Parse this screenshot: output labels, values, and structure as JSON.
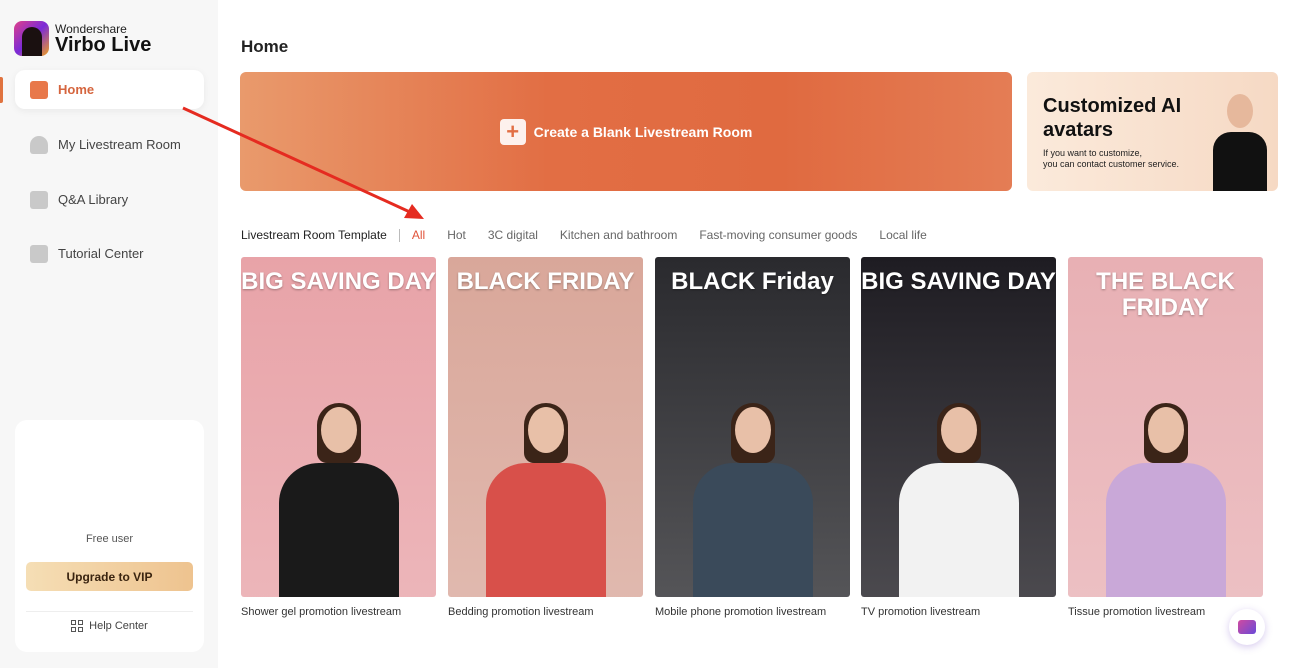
{
  "app": {
    "brand_small": "Wondershare",
    "brand_name": "Virbo Live"
  },
  "sidebar": {
    "items": [
      {
        "label": "Home",
        "icon": "home-icon",
        "active": true
      },
      {
        "label": "My Livestream Room",
        "icon": "avatar-icon"
      },
      {
        "label": "Q&A Library",
        "icon": "document-icon"
      },
      {
        "label": "Tutorial Center",
        "icon": "graduation-cap-icon"
      }
    ],
    "user": {
      "status": "Free user",
      "upgrade_label": "Upgrade to VIP",
      "help_label": "Help Center"
    }
  },
  "main": {
    "title": "Home",
    "create_label": "Create a Blank Livestream Room",
    "promo": {
      "title": "Customized AI avatars",
      "subtitle_line1": "If you want to customize,",
      "subtitle_line2": "you can contact customer service."
    },
    "templates_label": "Livestream Room Template",
    "tabs": [
      "All",
      "Hot",
      "3C digital",
      "Kitchen and bathroom",
      "Fast-moving consumer goods",
      "Local life"
    ],
    "active_tab": "All",
    "templates": [
      {
        "caption": "Shower gel promotion livestream",
        "headline": "BIG SAVING DAY",
        "bg": "#e8a3a8",
        "outfit": "#1a1a1a"
      },
      {
        "caption": "Bedding promotion livestream",
        "headline": "BLACK FRIDAY",
        "bg": "#d9a79a",
        "outfit": "#d8504a"
      },
      {
        "caption": "Mobile phone promotion livestream",
        "headline": "BLACK Friday",
        "bg": "#2a2a2e",
        "outfit": "#3a4a5a"
      },
      {
        "caption": "TV promotion livestream",
        "headline": "BIG SAVING DAY",
        "bg": "#1e1c22",
        "outfit": "#f2f2f2"
      },
      {
        "caption": "Tissue promotion livestream",
        "headline": "THE BLACK FRIDAY",
        "bg": "#e8b0b4",
        "outfit": "#c9a8d8"
      }
    ]
  },
  "colors": {
    "accent": "#e0733f",
    "active_tab": "#e0533a",
    "annotation_arrow": "#e52b20"
  }
}
